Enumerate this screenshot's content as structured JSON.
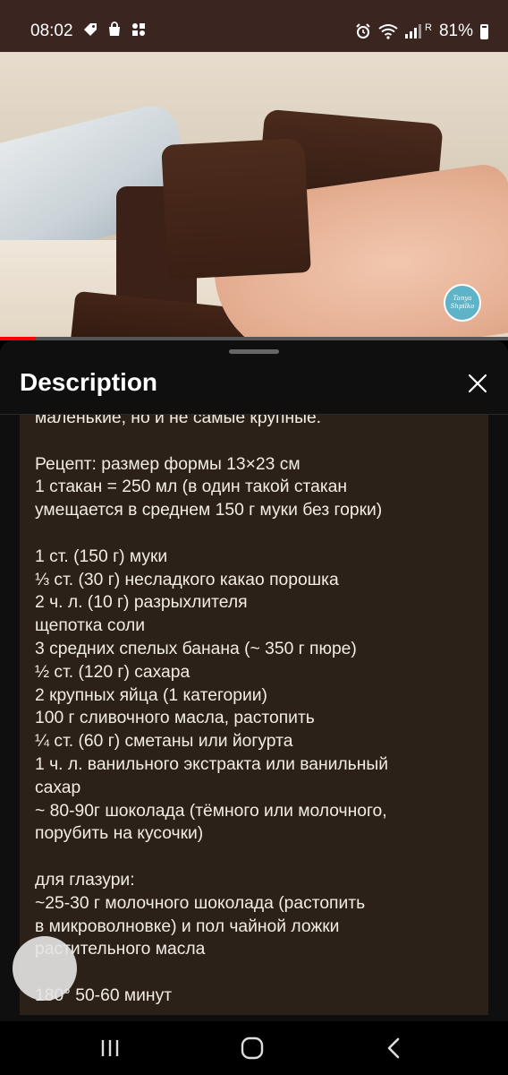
{
  "status_bar": {
    "time": "08:02",
    "battery": "81%",
    "network_label": "R"
  },
  "video": {
    "watermark_line1": "Tanya",
    "watermark_line2": "Shpilko",
    "progress_fraction": 0.07
  },
  "panel": {
    "title": "Description",
    "description_text": "маленькие, но и не самые крупные.\n\nРецепт: размер формы 13×23 см\n1 стакан = 250 мл (в один такой стакан\nумещается в среднем 150 г муки без горки)\n\n1 ст. (150 г) муки\n⅓ ст. (30 г) несладкого какао порошка\n2 ч. л. (10 г) разрыхлителя\nщепотка соли\n3 средних спелых банана (~ 350 г пюре)\n½ ст. (120 г) сахара\n2 крупных яйца (1 категории)\n100 г сливочного масла, растопить\n¼ ст. (60 г) сметаны или йогурта\n1 ч. л. ванильного экстракта или ванильный\nсахар\n~ 80-90г шоколада (тёмного или молочного,\nпорубить на кусочки)\n\nдля глазури:\n~25-30 г молочного шоколада (растопить\nв микроволновке) и пол чайной ложки\nрастительного масла\n\n180° 50-60 минут"
  },
  "icons": {
    "close": "close-icon",
    "alarm": "alarm-icon",
    "wifi": "wifi-icon",
    "signal": "signal-icon",
    "battery": "battery-icon",
    "nav_recents": "recents-icon",
    "nav_home": "home-icon",
    "nav_back": "back-icon"
  },
  "colors": {
    "status_bar_bg": "#3a2520",
    "panel_bg": "#0f0f0f",
    "description_bg": "#2c2118",
    "progress": "#ff0000"
  }
}
